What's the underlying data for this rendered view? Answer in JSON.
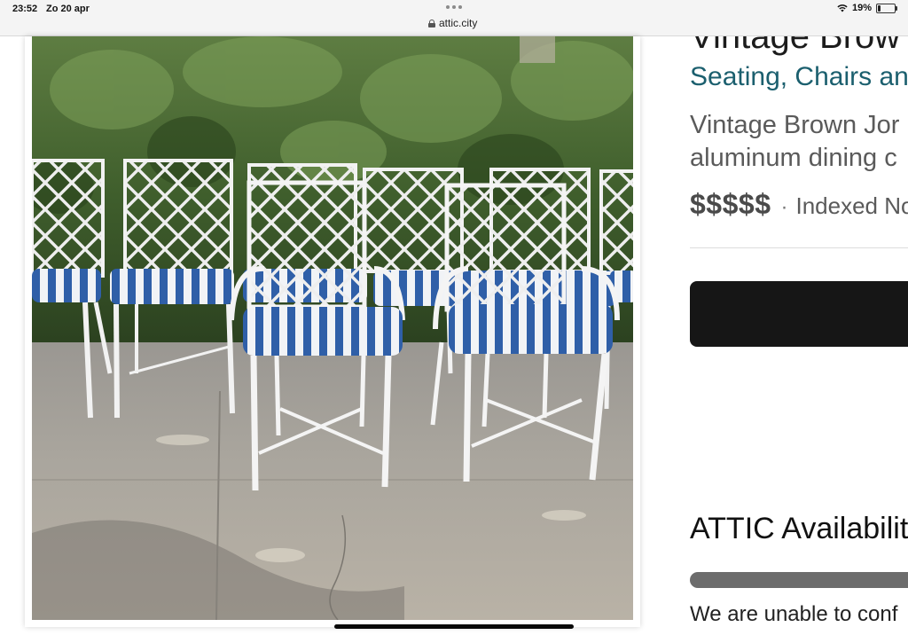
{
  "status_bar": {
    "time": "23:52",
    "date": "Zo 20 apr",
    "url": "attic.city",
    "battery_percent": "19%",
    "battery_level": 0.19,
    "icons": [
      "more-dots-icon",
      "lock-icon",
      "wifi-icon",
      "battery-icon"
    ]
  },
  "listing": {
    "title": "Vintage Brow",
    "category": "Seating, Chairs an",
    "description_line1": "Vintage Brown Jor",
    "description_line2": "aluminum dining c",
    "price": "$$$$$",
    "price_separator": "·",
    "indexed_text": "Indexed No",
    "availability_heading": "ATTIC Availability",
    "unable_text": "We are unable to conf"
  },
  "colors": {
    "category_link": "#1b5f6e",
    "cta_button": "#161616",
    "availability_bar": "#6c6c6c",
    "cushion_stripe": "#2f5fa8"
  }
}
